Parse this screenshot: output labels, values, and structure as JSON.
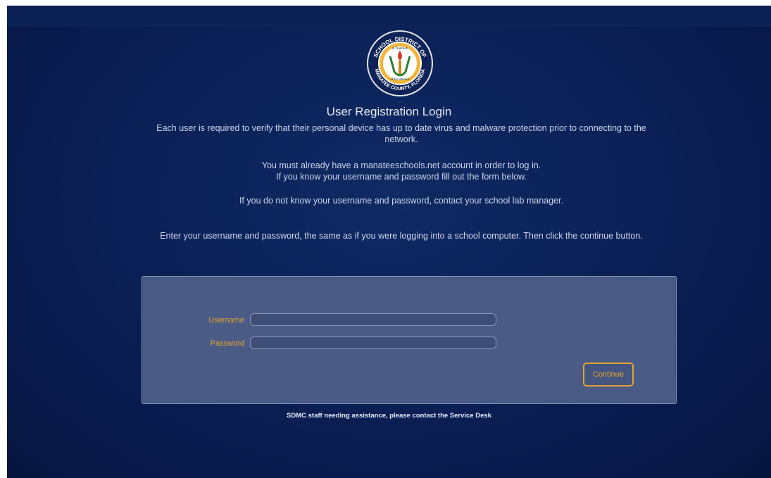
{
  "logo": {
    "top_text": "SCHOOL DISTRICT OF",
    "bottom_text": "MANATEE COUNTY, FLORIDA",
    "ribbon_top": "A Tradition",
    "ribbon_bottom": "of Excellence"
  },
  "title": "User Registration Login",
  "paragraphs": {
    "p1": "Each user is required to verify that their personal device has up to date virus and malware protection prior to connecting to the network.",
    "p2_line1": "You must already have a manateeschools.net account in order to log in.",
    "p2_line2": "If you know your username and password fill out the form below.",
    "p3": "If you do not know your username and password, contact your school lab manager.",
    "p4": "Enter your username and password, the same as if you were logging into a school computer. Then click the continue button."
  },
  "form": {
    "username_label": "Username",
    "username_value": "",
    "password_label": "Password",
    "password_value": "",
    "continue_label": "Continue"
  },
  "footer": "SDMC staff needing assistance, please contact the Service Desk",
  "colors": {
    "accent": "#e5a42e",
    "background": "#0b2158",
    "panel": "#4a5b86"
  }
}
